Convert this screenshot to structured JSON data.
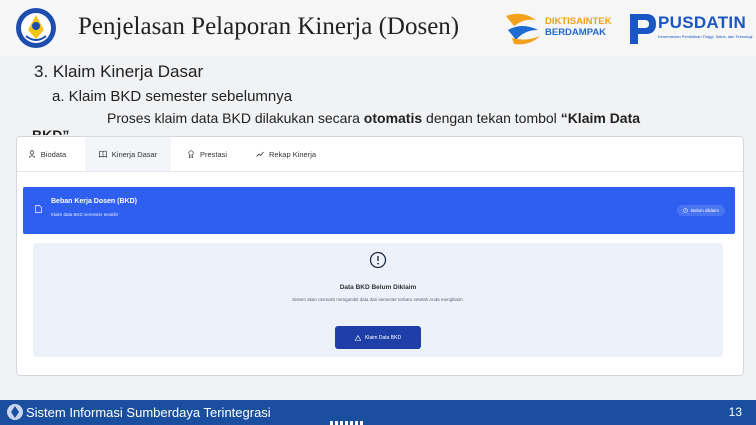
{
  "slide": {
    "title": "Penjelasan Pelaporan Kinerja (Dosen)",
    "heading": "3. Klaim Kinerja Dasar",
    "subheading": "a. Klaim BKD semester sebelumnya",
    "desc_pre": "Proses klaim data BKD dilakukan secara ",
    "desc_bold": "otomatis",
    "desc_mid": " dengan tekan tombol ",
    "desc_quote": "“Klaim Data",
    "desc_cut": "BKD”",
    "logos": {
      "dikti_line1": "DIKTISAINTEK",
      "dikti_line2": "BERDAMPAK",
      "pusdatin": "PUSDATIN",
      "pusdatin_sub": "Kementerian Pendidikan Tinggi, Sains, dan Teknologi"
    }
  },
  "app": {
    "tabs": [
      {
        "label": "Biodata",
        "icon": "user-icon"
      },
      {
        "label": "Kinerja Dasar",
        "icon": "book-icon"
      },
      {
        "label": "Prestasi",
        "icon": "award-icon"
      },
      {
        "label": "Rekap Kinerja",
        "icon": "trend-icon"
      }
    ],
    "banner": {
      "title": "Beban Kerja Dosen (BKD)",
      "subtitle": "Klaim data BKD semester terakhir",
      "badge": "Belum diklaim"
    },
    "empty_state": {
      "title": "Data BKD Belum Diklaim",
      "description": "Sistem akan otomatis mengambil data dari semester terbaru setelah Anda mengklaim.",
      "button": "Klaim Data BKD"
    }
  },
  "footer": {
    "text": "Sistem Informasi Sumberdaya Terintegrasi",
    "page": "13"
  },
  "colors": {
    "banner": "#2e5ff0",
    "button": "#1f3fa8",
    "footer": "#1a4fa0",
    "empty_card": "#edf1fa"
  }
}
